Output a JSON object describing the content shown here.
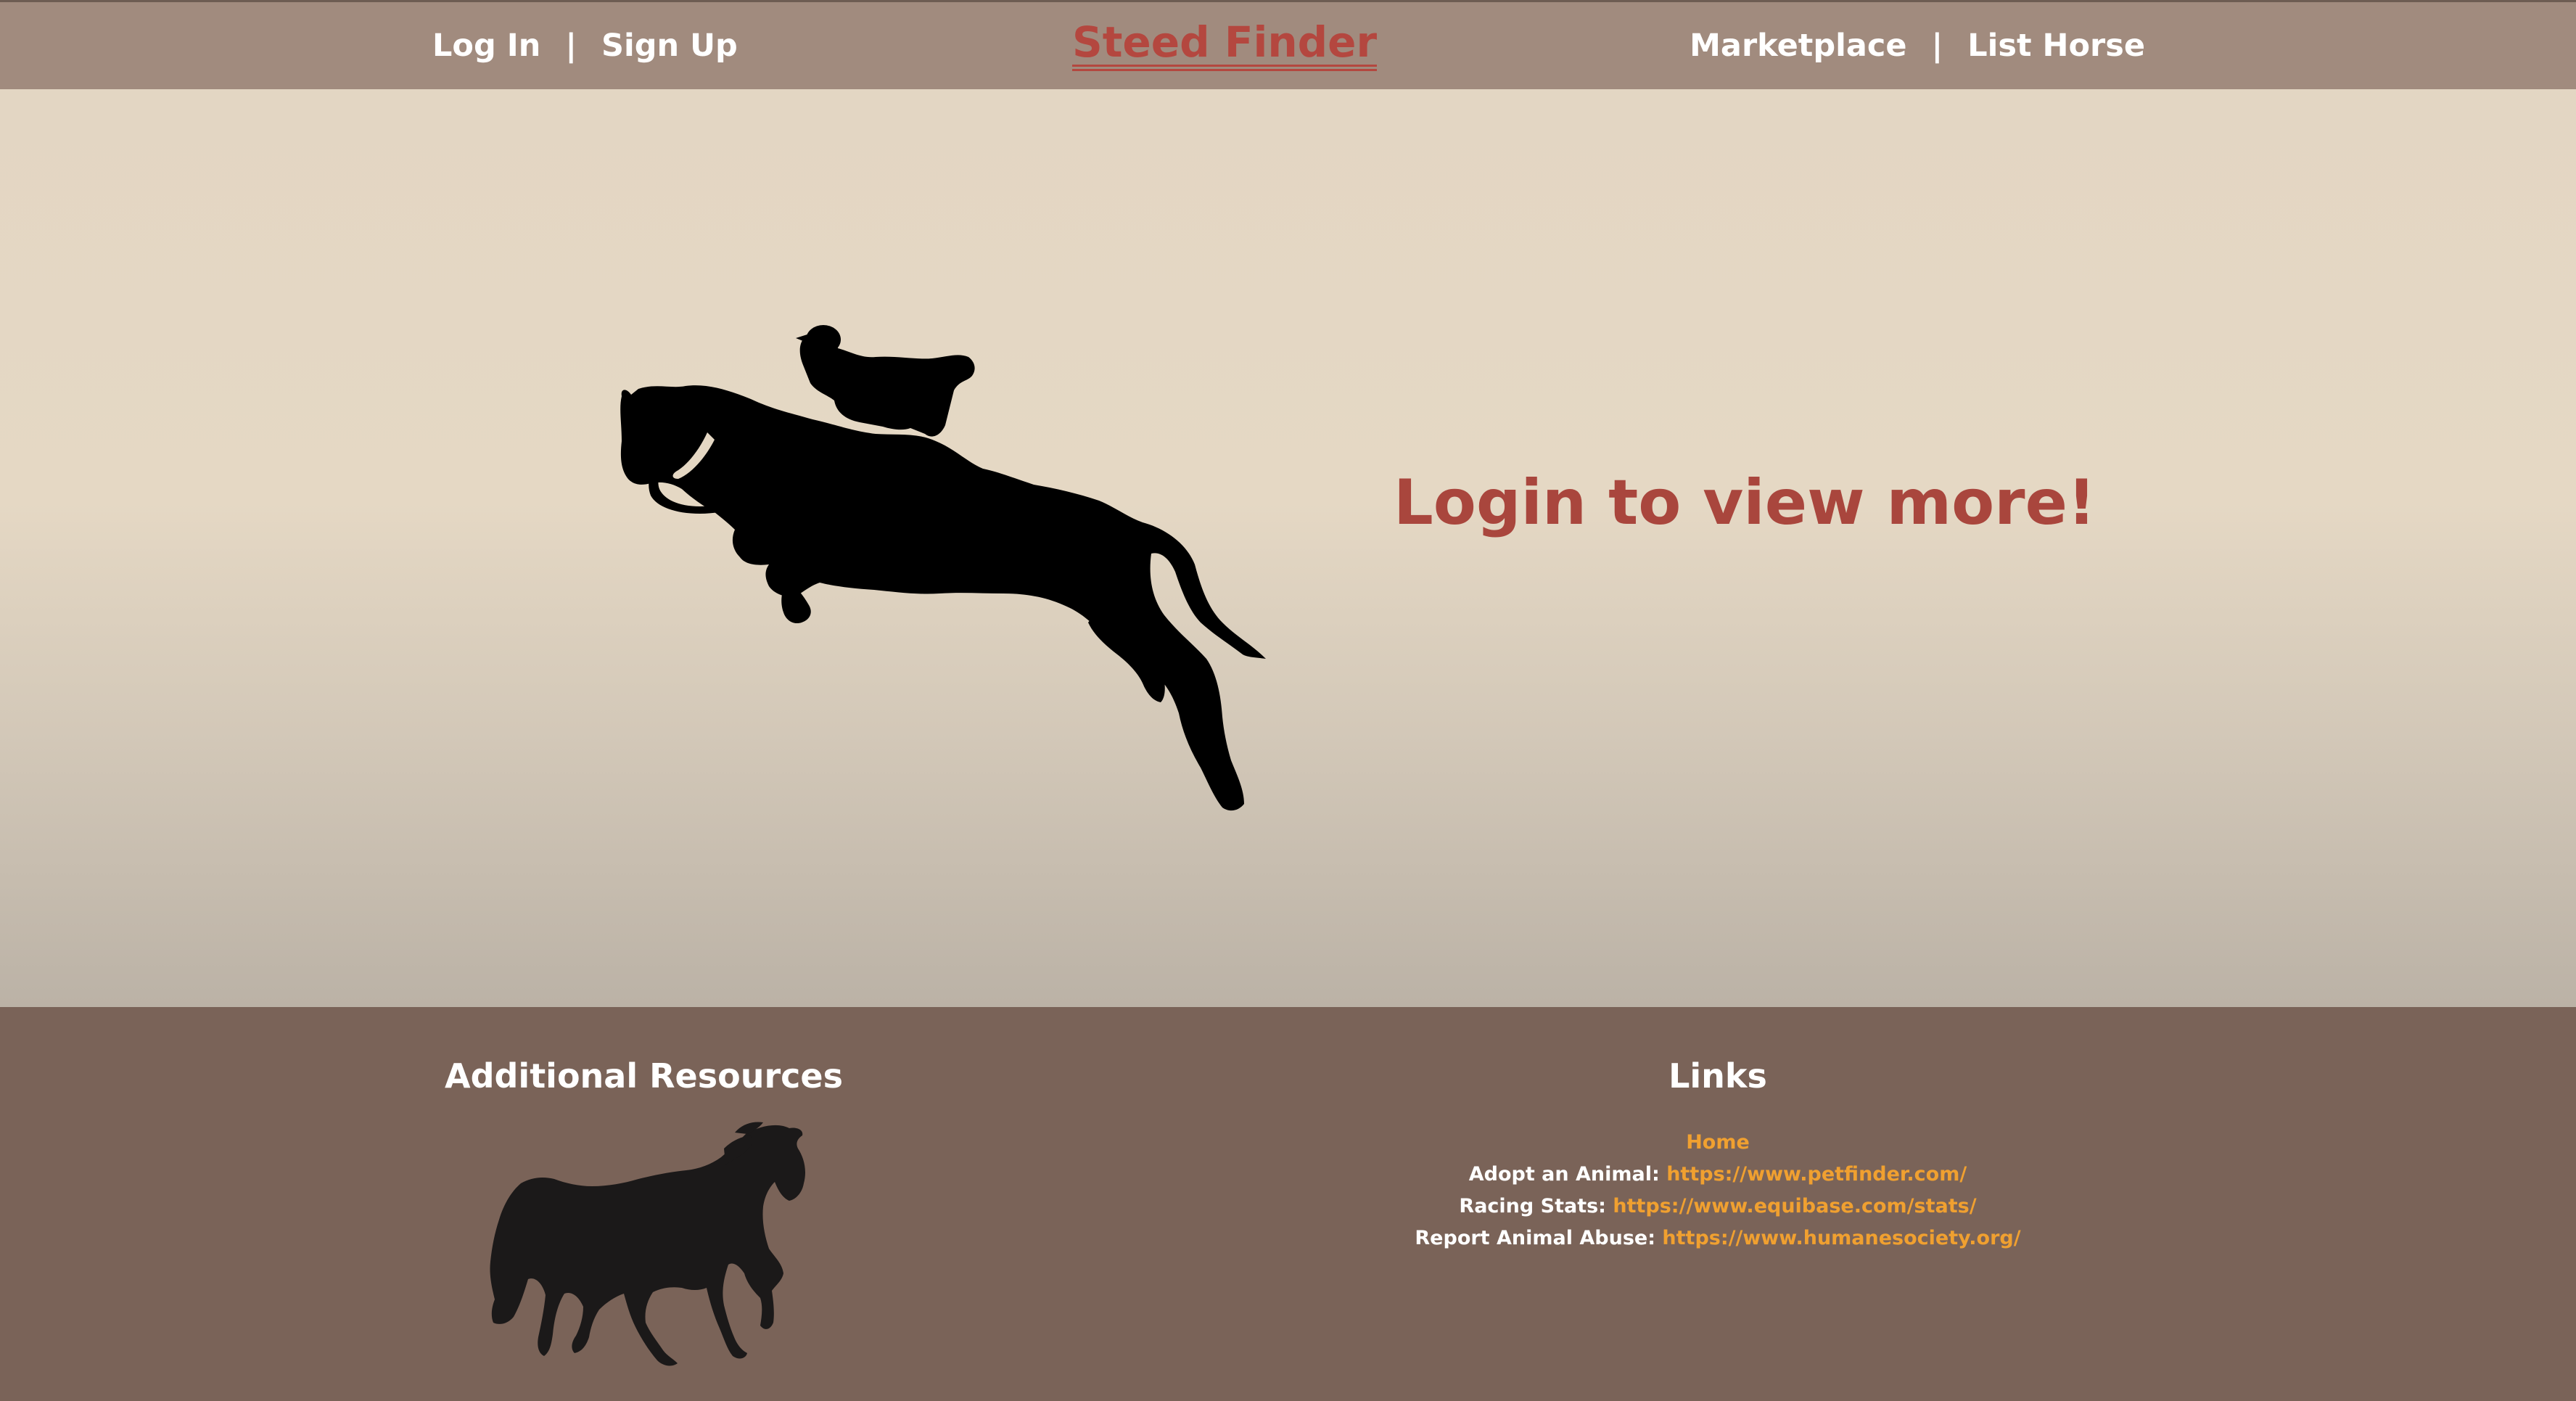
{
  "header": {
    "login_label": "Log In",
    "separator": "|",
    "signup_label": "Sign Up",
    "brand": "Steed Finder",
    "marketplace_label": "Marketplace",
    "list_horse_label": "List Horse"
  },
  "hero": {
    "image_icon": "horse-jumper-silhouette-icon",
    "message": "Login to view more!"
  },
  "footer": {
    "resources_title": "Additional Resources",
    "resources_icon": "horse-silhouette-icon",
    "links_title": "Links",
    "home_label": "Home",
    "links": [
      {
        "label": "Adopt an Animal:",
        "url": "https://www.petfinder.com/"
      },
      {
        "label": "Racing Stats:",
        "url": "https://www.equibase.com/stats/"
      },
      {
        "label": "Report Animal Abuse:",
        "url": "https://www.humanesociety.org/"
      }
    ]
  },
  "colors": {
    "header_bg": "#a18b7e",
    "brand": "#b4473f",
    "message": "#a9463d",
    "footer_bg": "#7a6358",
    "link": "#f0a030"
  }
}
